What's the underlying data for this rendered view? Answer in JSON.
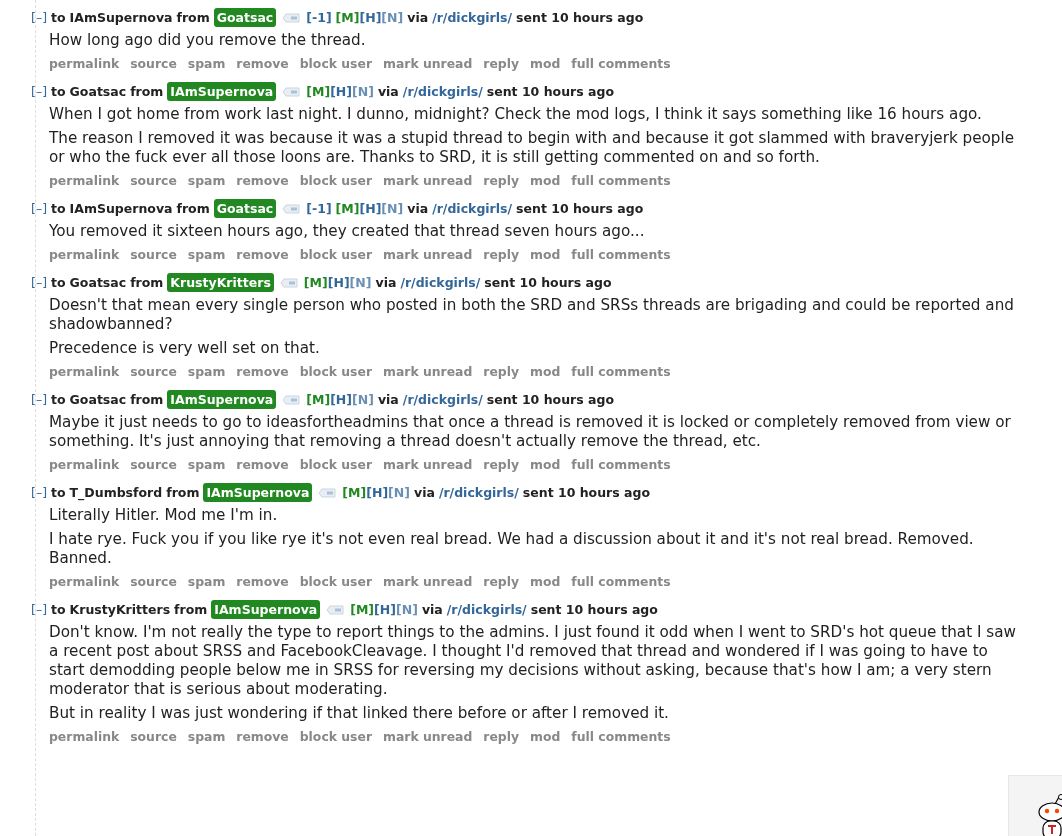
{
  "messages": [
    {
      "collapse": "[–]",
      "to_word": "to",
      "recipient": "IAmSupernova",
      "from_word": "from",
      "sender": "Goatsac",
      "score": "[-1]",
      "flags": [
        {
          "text": "[M]",
          "kind": "mod"
        },
        {
          "text": "[H]",
          "kind": "history"
        },
        {
          "text": "[N]",
          "kind": "note"
        }
      ],
      "via_word": "via",
      "subreddit": "/r/dickgirls/",
      "time": "sent 10 hours ago",
      "paragraphs": [
        "How long ago did you remove the thread."
      ],
      "actions": [
        "permalink",
        "source",
        "spam",
        "remove",
        "block user",
        "mark unread",
        "reply",
        "mod",
        "full comments"
      ]
    },
    {
      "collapse": "[–]",
      "to_word": "to",
      "recipient": "Goatsac",
      "from_word": "from",
      "sender": "IAmSupernova",
      "flags": [
        {
          "text": "[M]",
          "kind": "mod"
        },
        {
          "text": "[H]",
          "kind": "history"
        },
        {
          "text": "[N]",
          "kind": "note"
        }
      ],
      "via_word": "via",
      "subreddit": "/r/dickgirls/",
      "time": "sent 10 hours ago",
      "paragraphs": [
        "When I got home from work last night. I dunno, midnight? Check the mod logs, I think it says something like 16 hours ago.",
        "The reason I removed it was because it was a stupid thread to begin with and because it got slammed with braveryjerk people or who the fuck ever all those loons are. Thanks to SRD, it is still getting commented on and so forth."
      ],
      "actions": [
        "permalink",
        "source",
        "spam",
        "remove",
        "block user",
        "mark unread",
        "reply",
        "mod",
        "full comments"
      ]
    },
    {
      "collapse": "[–]",
      "to_word": "to",
      "recipient": "IAmSupernova",
      "from_word": "from",
      "sender": "Goatsac",
      "score": "[-1]",
      "flags": [
        {
          "text": "[M]",
          "kind": "mod"
        },
        {
          "text": "[H]",
          "kind": "history"
        },
        {
          "text": "[N]",
          "kind": "note"
        }
      ],
      "via_word": "via",
      "subreddit": "/r/dickgirls/",
      "time": "sent 10 hours ago",
      "paragraphs": [
        "You removed it sixteen hours ago, they created that thread seven hours ago..."
      ],
      "actions": [
        "permalink",
        "source",
        "spam",
        "remove",
        "block user",
        "mark unread",
        "reply",
        "mod",
        "full comments"
      ]
    },
    {
      "collapse": "[–]",
      "to_word": "to",
      "recipient": "Goatsac",
      "from_word": "from",
      "sender": "KrustyKritters",
      "flags": [
        {
          "text": "[M]",
          "kind": "mod"
        },
        {
          "text": "[H]",
          "kind": "history"
        },
        {
          "text": "[N]",
          "kind": "note"
        }
      ],
      "via_word": "via",
      "subreddit": "/r/dickgirls/",
      "time": "sent 10 hours ago",
      "paragraphs": [
        "Doesn't that mean every single person who posted in both the SRD and SRSs threads are brigading and could be reported and shadowbanned?",
        "Precedence is very well set on that."
      ],
      "actions": [
        "permalink",
        "source",
        "spam",
        "remove",
        "block user",
        "mark unread",
        "reply",
        "mod",
        "full comments"
      ]
    },
    {
      "collapse": "[–]",
      "to_word": "to",
      "recipient": "Goatsac",
      "from_word": "from",
      "sender": "IAmSupernova",
      "flags": [
        {
          "text": "[M]",
          "kind": "mod"
        },
        {
          "text": "[H]",
          "kind": "history"
        },
        {
          "text": "[N]",
          "kind": "note"
        }
      ],
      "via_word": "via",
      "subreddit": "/r/dickgirls/",
      "time": "sent 10 hours ago",
      "paragraphs": [
        "Maybe it just needs to go to ideasfortheadmins that once a thread is removed it is locked or completely removed from view or something. It's just annoying that removing a thread doesn't actually remove the thread, etc."
      ],
      "actions": [
        "permalink",
        "source",
        "spam",
        "remove",
        "block user",
        "mark unread",
        "reply",
        "mod",
        "full comments"
      ]
    },
    {
      "collapse": "[–]",
      "to_word": "to",
      "recipient": "T_Dumbsford",
      "from_word": "from",
      "sender": "IAmSupernova",
      "flags": [
        {
          "text": "[M]",
          "kind": "mod"
        },
        {
          "text": "[H]",
          "kind": "history"
        },
        {
          "text": "[N]",
          "kind": "note"
        }
      ],
      "via_word": "via",
      "subreddit": "/r/dickgirls/",
      "time": "sent 10 hours ago",
      "paragraphs": [
        "Literally Hitler. Mod me I'm in.",
        "I hate rye. Fuck you if you like rye it's not even real bread. We had a discussion about it and it's not real bread. Removed. Banned."
      ],
      "actions": [
        "permalink",
        "source",
        "spam",
        "remove",
        "block user",
        "mark unread",
        "reply",
        "mod",
        "full comments"
      ]
    },
    {
      "collapse": "[–]",
      "to_word": "to",
      "recipient": "KrustyKritters",
      "from_word": "from",
      "sender": "IAmSupernova",
      "flags": [
        {
          "text": "[M]",
          "kind": "mod"
        },
        {
          "text": "[H]",
          "kind": "history"
        },
        {
          "text": "[N]",
          "kind": "note"
        }
      ],
      "via_word": "via",
      "subreddit": "/r/dickgirls/",
      "time": "sent 10 hours ago",
      "paragraphs": [
        "Don't know. I'm not really the type to report things to the admins. I just found it odd when I went to SRD's hot queue that I saw a recent post about SRSS and FacebookCleavage. I thought I'd removed that thread and wondered if I was going to have to start demodding people below me in SRSS for reversing my decisions without asking, because that's how I am; a very stern moderator that is serious about moderating.",
        "But in reality I was just wondering if that linked there before or after I removed it."
      ],
      "actions": [
        "permalink",
        "source",
        "spam",
        "remove",
        "block user",
        "mark unread",
        "reply",
        "mod",
        "full comments"
      ]
    }
  ]
}
